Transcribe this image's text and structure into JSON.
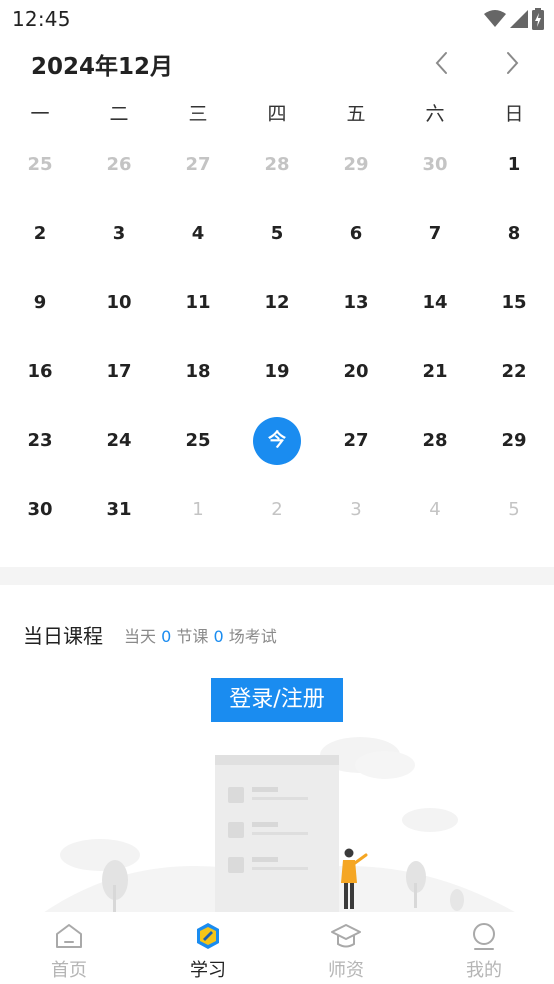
{
  "status_bar": {
    "time": "12:45"
  },
  "calendar": {
    "title": "2024年12月",
    "weekdays": [
      "一",
      "二",
      "三",
      "四",
      "五",
      "六",
      "日"
    ],
    "weeks": [
      [
        "25",
        "26",
        "27",
        "28",
        "29",
        "30",
        "1"
      ],
      [
        "2",
        "3",
        "4",
        "5",
        "6",
        "7",
        "8"
      ],
      [
        "9",
        "10",
        "11",
        "12",
        "13",
        "14",
        "15"
      ],
      [
        "16",
        "17",
        "18",
        "19",
        "20",
        "21",
        "22"
      ],
      [
        "23",
        "24",
        "25",
        "今",
        "27",
        "28",
        "29"
      ],
      [
        "30",
        "31",
        "1",
        "2",
        "3",
        "4",
        "5"
      ]
    ],
    "today_label": "今",
    "accent_color": "#1a8cf0"
  },
  "course": {
    "title": "当日课程",
    "summary_prefix": "当天",
    "lesson_count": "0",
    "summary_mid": "节课",
    "exam_count": "0",
    "summary_suffix": "场考试"
  },
  "login_button": "登录/注册",
  "tabs": [
    {
      "label": "首页",
      "icon": "home-icon",
      "active": false
    },
    {
      "label": "学习",
      "icon": "study-icon",
      "active": true
    },
    {
      "label": "师资",
      "icon": "teacher-icon",
      "active": false
    },
    {
      "label": "我的",
      "icon": "profile-icon",
      "active": false
    }
  ]
}
